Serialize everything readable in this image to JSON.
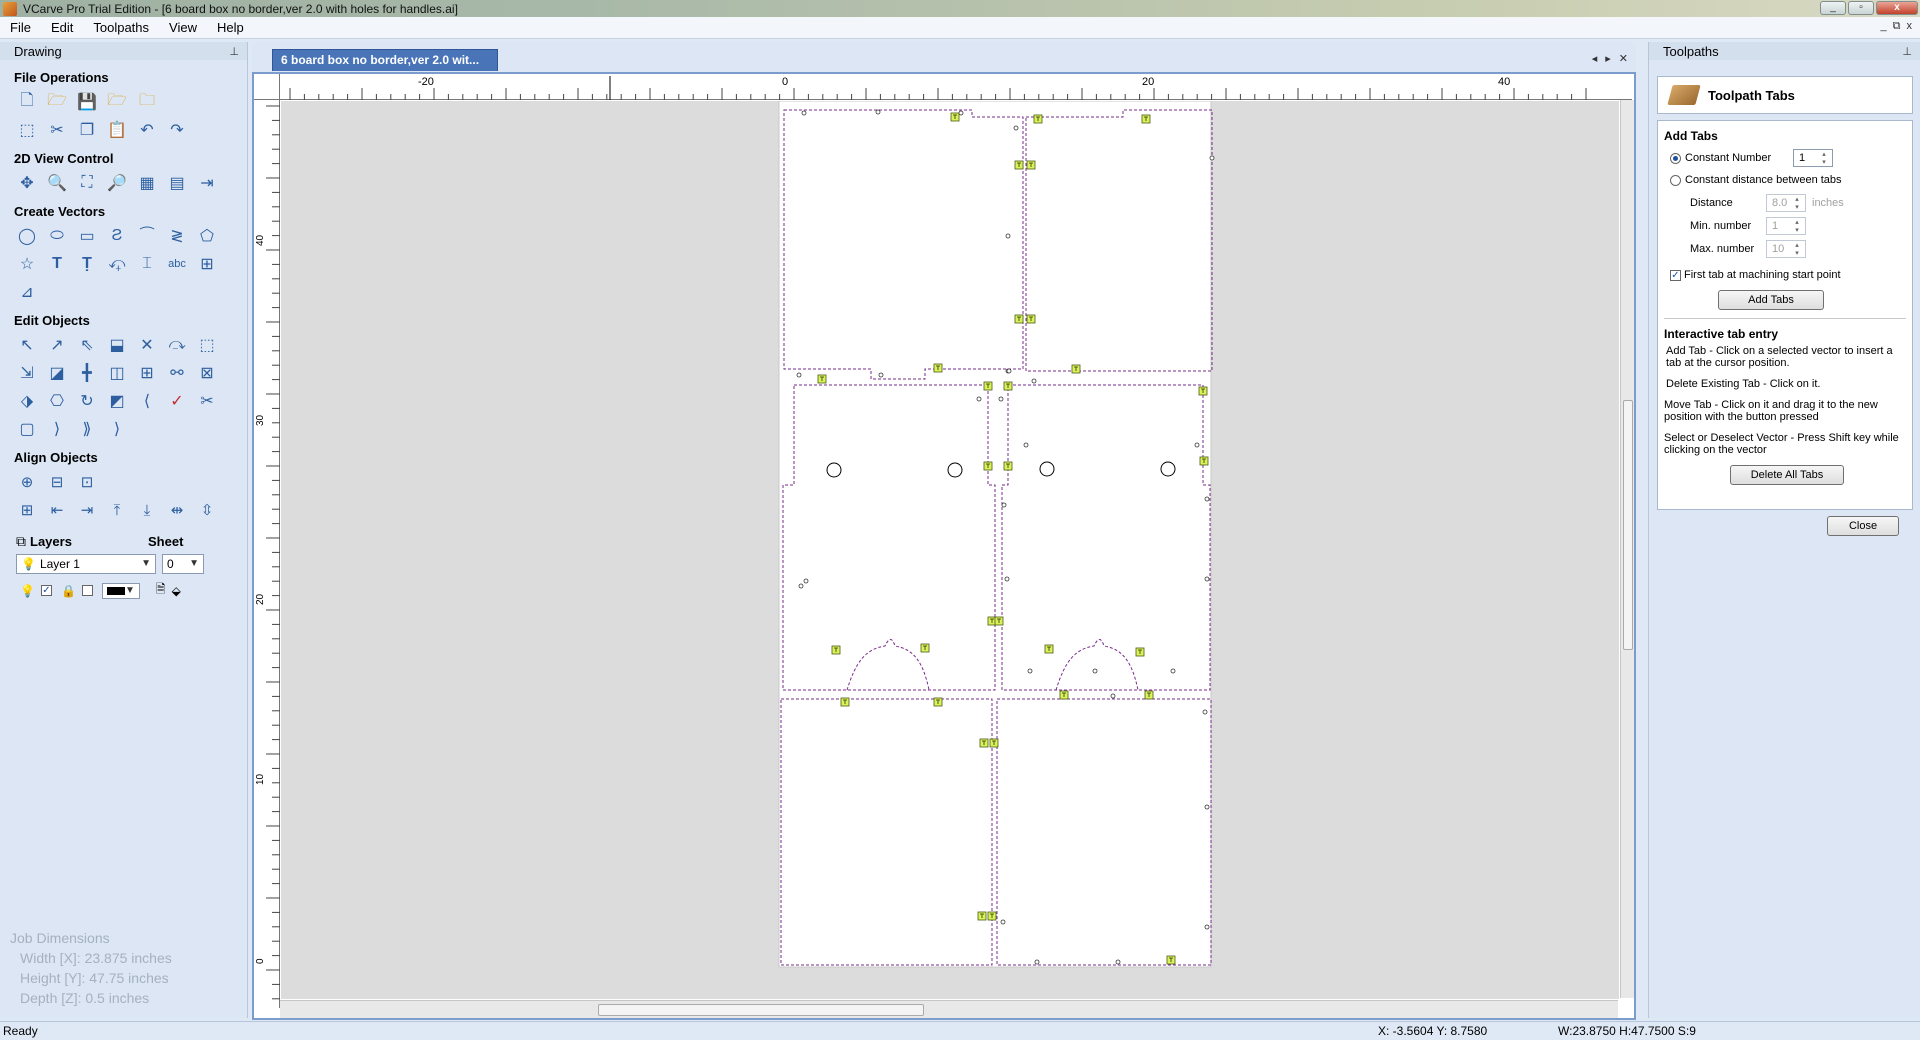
{
  "window": {
    "title": "VCarve Pro Trial Edition - [6 board box no border,ver 2.0 with holes for handles.ai]",
    "controls": [
      "_",
      "▫",
      "x"
    ]
  },
  "menu": [
    "File",
    "Edit",
    "Toolpaths",
    "View",
    "Help"
  ],
  "menu_window_controls": [
    "_",
    "⧉",
    "x"
  ],
  "left_panel": {
    "title": "Drawing",
    "sections": {
      "file_ops": "File Operations",
      "view_control": "2D View Control",
      "create_vectors": "Create Vectors",
      "edit_objects": "Edit Objects",
      "align_objects": "Align Objects"
    },
    "layers_label": "Layers",
    "sheet_label": "Sheet",
    "layer_value": "Layer 1",
    "sheet_value": "0",
    "job_dims": {
      "title": "Job Dimensions",
      "width": "Width  [X]: 23.875 inches",
      "height": "Height [Y]: 47.75 inches",
      "depth": "Depth  [Z]: 0.5 inches"
    }
  },
  "doc_tab": {
    "label": "6 board box no border,ver 2.0 wit..."
  },
  "rulers": {
    "top": [
      "-20",
      "0",
      "20",
      "40"
    ],
    "left": [
      "40",
      "30",
      "20",
      "10",
      "0"
    ]
  },
  "right_panel": {
    "title": "Toolpaths",
    "tool_title": "Toolpath Tabs",
    "add_tabs_label": "Add Tabs",
    "constant_number_label": "Constant Number",
    "constant_number_value": "1",
    "constant_distance_label": "Constant distance between tabs",
    "distance_label": "Distance",
    "distance_value": "8.0",
    "distance_units": "inches",
    "min_label": "Min. number",
    "min_value": "1",
    "max_label": "Max. number",
    "max_value": "10",
    "first_tab_label": "First tab at machining start point",
    "add_tabs_button": "Add Tabs",
    "interactive_title": "Interactive tab entry",
    "help1": "Add Tab - Click on a selected vector to insert a tab at the cursor position.",
    "help2": "Delete Existing Tab - Click on it.",
    "help3": "Move Tab - Click on it and drag it to the new position with the button pressed",
    "help4": "Select or Deselect Vector - Press Shift key while clicking on the vector",
    "delete_all_button": "Delete All Tabs",
    "close_button": "Close"
  },
  "status": {
    "left": "Ready",
    "xy": "X: -3.5604 Y:  8.7580",
    "wh": "W:23.8750   H:47.7500  S:9"
  },
  "colors": {
    "accent": "#4a74b8",
    "vector": "#7a2a8c",
    "tab": "#d9f25a"
  }
}
